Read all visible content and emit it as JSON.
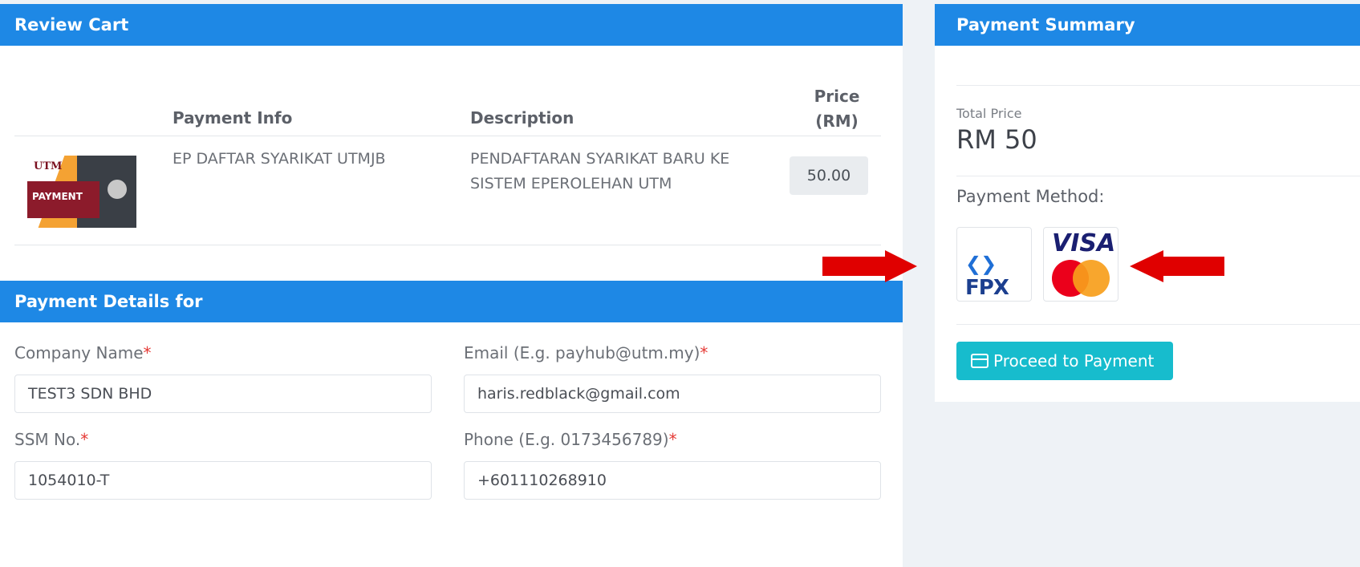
{
  "review_cart": {
    "title": "Review Cart",
    "headers": {
      "payment_info": "Payment Info",
      "description": "Description",
      "price": "Price (RM)"
    },
    "items": [
      {
        "thumbnail_logo": "UTM",
        "thumbnail_text": "PAYMENT",
        "payment_info": "EP DAFTAR SYARIKAT UTMJB",
        "description": "PENDAFTARAN SYARIKAT BARU KE SISTEM EPEROLEHAN UTM",
        "price": "50.00"
      }
    ]
  },
  "payment_details": {
    "title": "Payment Details for",
    "fields": {
      "company_name": {
        "label": "Company Name",
        "value": "TEST3 SDN BHD"
      },
      "email": {
        "label": "Email (E.g. payhub@utm.my)",
        "value": "haris.redblack@gmail.com"
      },
      "ssm_no": {
        "label": "SSM No.",
        "value": "1054010-T"
      },
      "phone": {
        "label": "Phone (E.g. 0173456789)",
        "value": "+601110268910"
      }
    },
    "required_marker": "*"
  },
  "payment_summary": {
    "title": "Payment Summary",
    "total_price_label": "Total Price",
    "total_price_value": "RM 50",
    "payment_method_label": "Payment Method:",
    "methods": [
      {
        "name": "FPX",
        "icon": "fpx-logo-icon"
      },
      {
        "name": "VISA",
        "icon": "visa-mastercard-icon"
      }
    ],
    "proceed_label": "Proceed to Payment"
  },
  "colors": {
    "header_blue": "#1e88e5",
    "button_teal": "#17bccd",
    "arrow_red": "#e00000",
    "required_red": "#e53935"
  }
}
